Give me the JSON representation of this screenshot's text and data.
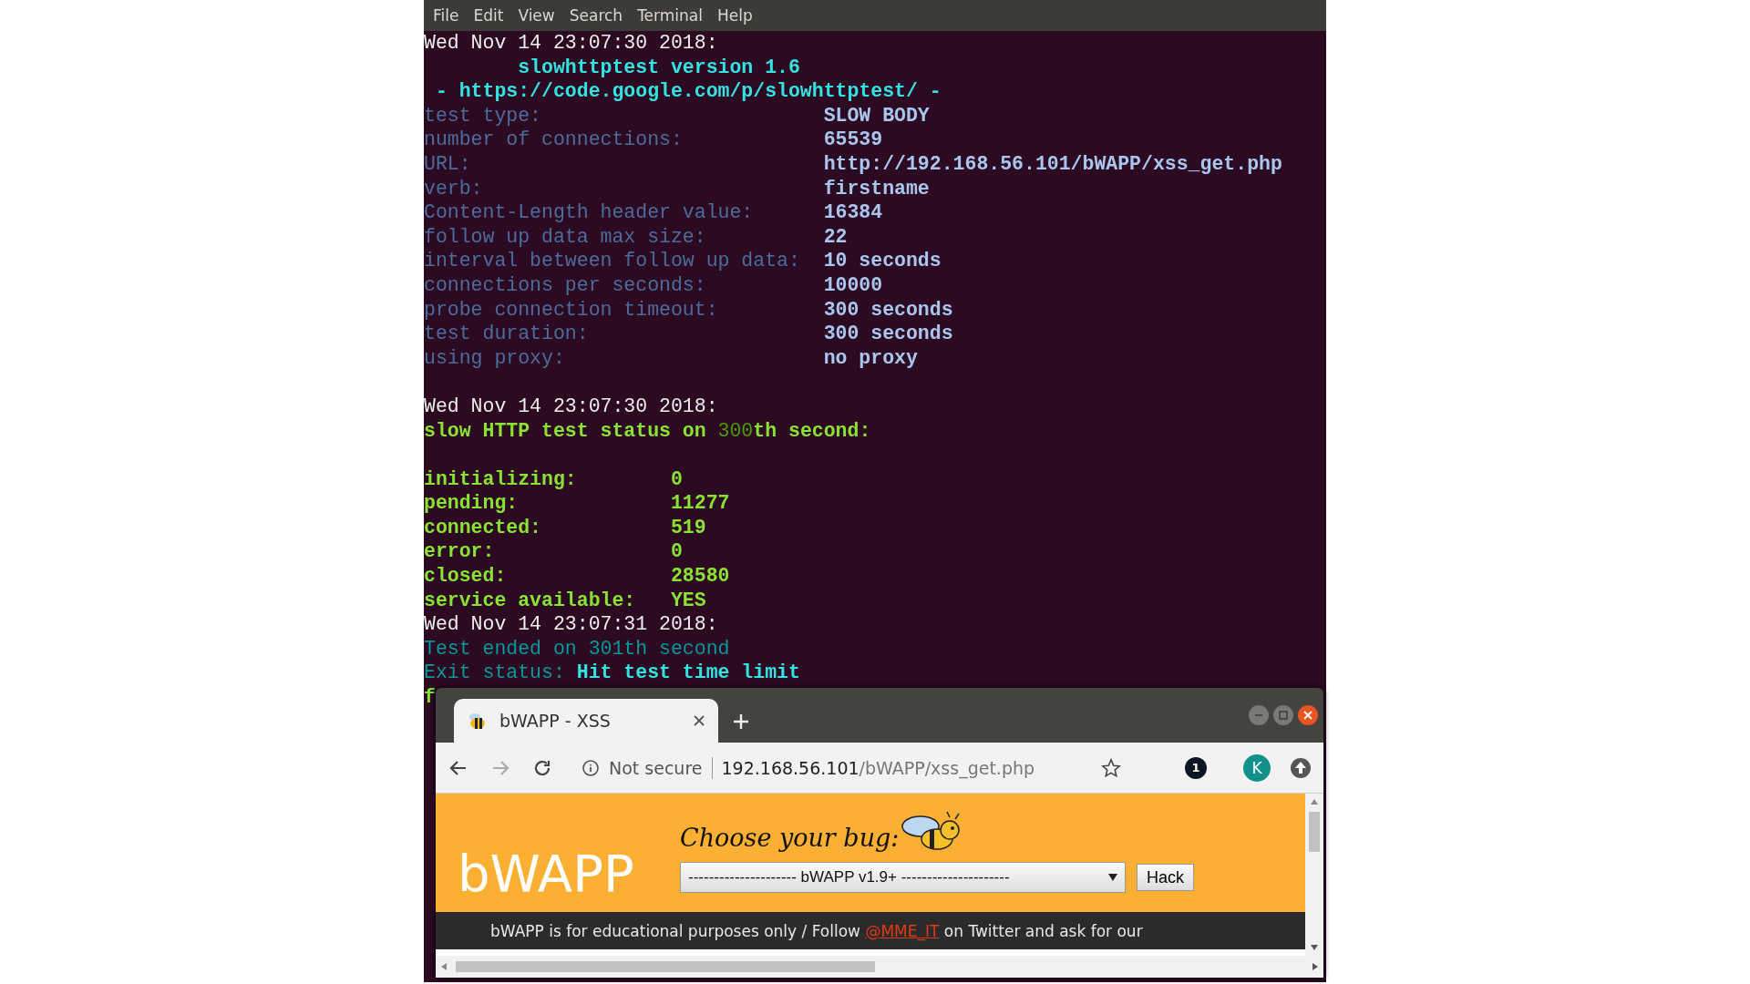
{
  "terminal": {
    "menu": [
      "File",
      "Edit",
      "View",
      "Search",
      "Terminal",
      "Help"
    ],
    "lines": [
      {
        "kind": "text",
        "segments": [
          {
            "text": "Wed Nov 14 23:07:30 2018:",
            "kind": "plain"
          }
        ]
      },
      {
        "kind": "text",
        "segments": [
          {
            "text": "        slowhttptest version 1.6",
            "kind": "cyan"
          }
        ]
      },
      {
        "kind": "text",
        "segments": [
          {
            "text": " - https://code.google.com/p/slowhttptest/ -",
            "kind": "cyan"
          }
        ]
      },
      {
        "kind": "setting",
        "label": "test type:",
        "value": "SLOW BODY"
      },
      {
        "kind": "setting",
        "label": "number of connections:",
        "value": "65539"
      },
      {
        "kind": "setting",
        "label": "URL:",
        "value": "http://192.168.56.101/bWAPP/xss_get.php"
      },
      {
        "kind": "setting",
        "label": "verb:",
        "value": "firstname"
      },
      {
        "kind": "setting",
        "label": "Content-Length header value:",
        "value": "16384"
      },
      {
        "kind": "setting",
        "label": "follow up data max size:",
        "value": "22"
      },
      {
        "kind": "setting",
        "label": "interval between follow up data:",
        "value": "10 seconds"
      },
      {
        "kind": "setting",
        "label": "connections per seconds:",
        "value": "10000"
      },
      {
        "kind": "setting",
        "label": "probe connection timeout:",
        "value": "300 seconds"
      },
      {
        "kind": "setting",
        "label": "test duration:",
        "value": "300 seconds"
      },
      {
        "kind": "setting",
        "label": "using proxy:",
        "value": "no proxy"
      },
      {
        "kind": "blank"
      },
      {
        "kind": "text",
        "segments": [
          {
            "text": "Wed Nov 14 23:07:30 2018:",
            "kind": "plain"
          }
        ]
      },
      {
        "kind": "text",
        "segments": [
          {
            "text": "slow HTTP test status on ",
            "kind": "green"
          },
          {
            "text": "300",
            "kind": "darkgreen"
          },
          {
            "text": "th second:",
            "kind": "green"
          }
        ]
      },
      {
        "kind": "blank"
      },
      {
        "kind": "counter",
        "label": "initializing:",
        "value": "0"
      },
      {
        "kind": "counter",
        "label": "pending:",
        "value": "11277"
      },
      {
        "kind": "counter",
        "label": "connected:",
        "value": "519"
      },
      {
        "kind": "counter",
        "label": "error:",
        "value": "0"
      },
      {
        "kind": "counter",
        "label": "closed:",
        "value": "28580"
      },
      {
        "kind": "counter",
        "label": "service available:",
        "value": "YES"
      },
      {
        "kind": "text",
        "segments": [
          {
            "text": "Wed Nov 14 23:07:31 2018:",
            "kind": "plain"
          }
        ]
      },
      {
        "kind": "text",
        "segments": [
          {
            "text": "Test ended on 301th second",
            "kind": "teal"
          }
        ]
      },
      {
        "kind": "text",
        "segments": [
          {
            "text": "Exit status: ",
            "kind": "teal"
          },
          {
            "text": "Hit test time limit",
            "kind": "cyan"
          }
        ]
      },
      {
        "kind": "text",
        "segments": [
          {
            "text": "f",
            "kind": "green"
          }
        ]
      }
    ]
  },
  "browser": {
    "tabs": [
      {
        "title": "bWAPP - XSS",
        "selected": true
      }
    ],
    "nav": [
      {
        "kind": "back",
        "disabled": false
      },
      {
        "kind": "forward",
        "disabled": true
      },
      {
        "kind": "reload",
        "disabled": false
      }
    ],
    "security": "Not secure",
    "url_host": "192.168.56.101",
    "url_path": "/bWAPP/xss_get.php",
    "extension_badge": "1",
    "avatar": "K",
    "page": {
      "heading": "Choose your bug:",
      "logo": "bWAPP",
      "select_value": "--------------------- bWAPP v1.9+ ---------------------",
      "button": "Hack",
      "footer_before": "bWAPP is for educational purposes only / Follow ",
      "footer_link": "@MME_IT",
      "footer_after": " on Twitter and ask for our"
    }
  }
}
